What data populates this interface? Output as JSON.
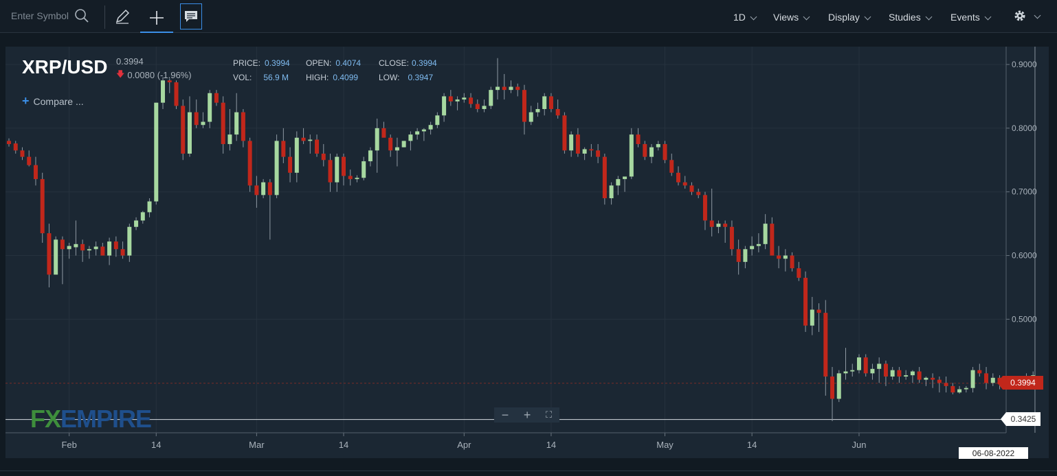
{
  "toolbar": {
    "symbol_placeholder": "Enter Symbol",
    "menus": [
      "1D",
      "Views",
      "Display",
      "Studies",
      "Events"
    ]
  },
  "header": {
    "symbol": "XRP/USD",
    "price": "0.3994",
    "change": "0.0080 (-1.96%)",
    "compare_label": "Compare ...",
    "stats": {
      "price_label": "PRICE:",
      "price": "0.3994",
      "vol_label": "VOL:",
      "vol": "56.9 M",
      "open_label": "OPEN:",
      "open": "0.4074",
      "high_label": "HIGH:",
      "high": "0.4099",
      "close_label": "CLOSE:",
      "close": "0.3994",
      "low_label": "LOW:",
      "low": "0.3947"
    }
  },
  "logo": {
    "fx": "FX",
    "empire": "EMPIRE"
  },
  "axis": {
    "last_price_tag": "0.3994",
    "crosshair_price_tag": "0.3425",
    "crosshair_date_tag": "06-08-2022"
  },
  "colors": {
    "up": "#a7d8a0",
    "down": "#c1271b",
    "background": "#1b2733",
    "accent": "#3b8fe8"
  },
  "chart_data": {
    "type": "candlestick",
    "title": "XRP/USD",
    "y_ticks": [
      "0.9000",
      "0.8000",
      "0.7000",
      "0.6000",
      "0.5000"
    ],
    "ylim": [
      0.32,
      0.93
    ],
    "x_ticks": [
      "Feb",
      "14",
      "Mar",
      "14",
      "Apr",
      "14",
      "May",
      "14",
      "Jun"
    ],
    "x_tick_days": [
      9,
      22,
      37,
      50,
      68,
      81,
      98,
      111,
      127
    ],
    "last_price": 0.3994,
    "crosshair_price": 0.3425,
    "candles": [
      [
        0.78,
        0.784,
        0.771,
        0.775
      ],
      [
        0.776,
        0.78,
        0.76,
        0.765
      ],
      [
        0.765,
        0.77,
        0.75,
        0.755
      ],
      [
        0.755,
        0.765,
        0.74,
        0.742
      ],
      [
        0.742,
        0.755,
        0.71,
        0.72
      ],
      [
        0.72,
        0.73,
        0.62,
        0.635
      ],
      [
        0.635,
        0.65,
        0.55,
        0.57
      ],
      [
        0.57,
        0.63,
        0.6,
        0.625
      ],
      [
        0.625,
        0.63,
        0.555,
        0.61
      ],
      [
        0.61,
        0.62,
        0.595,
        0.615
      ],
      [
        0.613,
        0.655,
        0.6,
        0.618
      ],
      [
        0.618,
        0.625,
        0.59,
        0.608
      ],
      [
        0.608,
        0.615,
        0.595,
        0.61
      ],
      [
        0.61,
        0.622,
        0.6,
        0.614
      ],
      [
        0.614,
        0.62,
        0.6,
        0.6
      ],
      [
        0.6,
        0.628,
        0.585,
        0.622
      ],
      [
        0.622,
        0.63,
        0.598,
        0.61
      ],
      [
        0.61,
        0.622,
        0.595,
        0.6
      ],
      [
        0.6,
        0.65,
        0.59,
        0.645
      ],
      [
        0.645,
        0.66,
        0.64,
        0.655
      ],
      [
        0.655,
        0.67,
        0.65,
        0.668
      ],
      [
        0.668,
        0.69,
        0.66,
        0.685
      ],
      [
        0.685,
        0.84,
        0.68,
        0.84
      ],
      [
        0.84,
        0.88,
        0.83,
        0.875
      ],
      [
        0.875,
        0.878,
        0.855,
        0.872
      ],
      [
        0.872,
        0.875,
        0.83,
        0.835
      ],
      [
        0.835,
        0.845,
        0.75,
        0.76
      ],
      [
        0.76,
        0.85,
        0.755,
        0.825
      ],
      [
        0.825,
        0.845,
        0.8,
        0.805
      ],
      [
        0.805,
        0.825,
        0.8,
        0.81
      ],
      [
        0.81,
        0.86,
        0.8,
        0.855
      ],
      [
        0.855,
        0.86,
        0.835,
        0.84
      ],
      [
        0.84,
        0.85,
        0.76,
        0.775
      ],
      [
        0.775,
        0.83,
        0.765,
        0.79
      ],
      [
        0.79,
        0.855,
        0.78,
        0.825
      ],
      [
        0.825,
        0.83,
        0.77,
        0.78
      ],
      [
        0.78,
        0.785,
        0.7,
        0.71
      ],
      [
        0.71,
        0.725,
        0.675,
        0.695
      ],
      [
        0.695,
        0.72,
        0.69,
        0.715
      ],
      [
        0.715,
        0.72,
        0.625,
        0.695
      ],
      [
        0.695,
        0.79,
        0.69,
        0.78
      ],
      [
        0.78,
        0.8,
        0.745,
        0.755
      ],
      [
        0.755,
        0.77,
        0.715,
        0.73
      ],
      [
        0.73,
        0.795,
        0.715,
        0.785
      ],
      [
        0.785,
        0.8,
        0.775,
        0.78
      ],
      [
        0.78,
        0.79,
        0.76,
        0.782
      ],
      [
        0.782,
        0.79,
        0.755,
        0.76
      ],
      [
        0.76,
        0.775,
        0.74,
        0.75
      ],
      [
        0.75,
        0.76,
        0.7,
        0.715
      ],
      [
        0.715,
        0.76,
        0.7,
        0.755
      ],
      [
        0.755,
        0.76,
        0.71,
        0.725
      ],
      [
        0.725,
        0.735,
        0.71,
        0.72
      ],
      [
        0.72,
        0.726,
        0.715,
        0.722
      ],
      [
        0.722,
        0.755,
        0.718,
        0.748
      ],
      [
        0.748,
        0.77,
        0.74,
        0.765
      ],
      [
        0.765,
        0.815,
        0.73,
        0.8
      ],
      [
        0.8,
        0.81,
        0.79,
        0.785
      ],
      [
        0.785,
        0.79,
        0.755,
        0.765
      ],
      [
        0.765,
        0.785,
        0.74,
        0.77
      ],
      [
        0.77,
        0.78,
        0.77,
        0.78
      ],
      [
        0.78,
        0.795,
        0.765,
        0.79
      ],
      [
        0.79,
        0.8,
        0.782,
        0.795
      ],
      [
        0.795,
        0.8,
        0.78,
        0.798
      ],
      [
        0.798,
        0.81,
        0.79,
        0.805
      ],
      [
        0.805,
        0.825,
        0.8,
        0.82
      ],
      [
        0.82,
        0.855,
        0.81,
        0.85
      ],
      [
        0.85,
        0.86,
        0.835,
        0.842
      ],
      [
        0.842,
        0.85,
        0.828,
        0.845
      ],
      [
        0.845,
        0.855,
        0.84,
        0.848
      ],
      [
        0.848,
        0.855,
        0.832,
        0.838
      ],
      [
        0.838,
        0.845,
        0.825,
        0.83
      ],
      [
        0.83,
        0.845,
        0.825,
        0.835
      ],
      [
        0.835,
        0.865,
        0.83,
        0.86
      ],
      [
        0.86,
        0.91,
        0.845,
        0.865
      ],
      [
        0.865,
        0.885,
        0.845,
        0.86
      ],
      [
        0.86,
        0.875,
        0.855,
        0.865
      ],
      [
        0.865,
        0.87,
        0.85,
        0.86
      ],
      [
        0.86,
        0.868,
        0.79,
        0.81
      ],
      [
        0.81,
        0.835,
        0.805,
        0.825
      ],
      [
        0.825,
        0.84,
        0.818,
        0.83
      ],
      [
        0.83,
        0.855,
        0.82,
        0.85
      ],
      [
        0.85,
        0.855,
        0.825,
        0.83
      ],
      [
        0.83,
        0.845,
        0.815,
        0.82
      ],
      [
        0.82,
        0.825,
        0.76,
        0.765
      ],
      [
        0.765,
        0.795,
        0.755,
        0.79
      ],
      [
        0.79,
        0.8,
        0.755,
        0.76
      ],
      [
        0.76,
        0.77,
        0.75,
        0.767
      ],
      [
        0.767,
        0.775,
        0.755,
        0.765
      ],
      [
        0.765,
        0.775,
        0.745,
        0.755
      ],
      [
        0.755,
        0.76,
        0.68,
        0.69
      ],
      [
        0.69,
        0.715,
        0.68,
        0.71
      ],
      [
        0.71,
        0.725,
        0.695,
        0.72
      ],
      [
        0.72,
        0.72,
        0.7,
        0.724
      ],
      [
        0.724,
        0.8,
        0.72,
        0.79
      ],
      [
        0.79,
        0.8,
        0.77,
        0.775
      ],
      [
        0.775,
        0.78,
        0.75,
        0.755
      ],
      [
        0.755,
        0.775,
        0.745,
        0.77
      ],
      [
        0.77,
        0.78,
        0.765,
        0.775
      ],
      [
        0.775,
        0.78,
        0.745,
        0.75
      ],
      [
        0.75,
        0.76,
        0.725,
        0.73
      ],
      [
        0.73,
        0.74,
        0.71,
        0.715
      ],
      [
        0.715,
        0.725,
        0.705,
        0.71
      ],
      [
        0.71,
        0.715,
        0.695,
        0.7
      ],
      [
        0.7,
        0.705,
        0.69,
        0.695
      ],
      [
        0.695,
        0.7,
        0.64,
        0.655
      ],
      [
        0.655,
        0.705,
        0.63,
        0.645
      ],
      [
        0.645,
        0.655,
        0.635,
        0.65
      ],
      [
        0.65,
        0.655,
        0.62,
        0.645
      ],
      [
        0.645,
        0.655,
        0.6,
        0.61
      ],
      [
        0.61,
        0.625,
        0.57,
        0.59
      ],
      [
        0.59,
        0.615,
        0.58,
        0.61
      ],
      [
        0.61,
        0.63,
        0.6,
        0.615
      ],
      [
        0.615,
        0.635,
        0.605,
        0.618
      ],
      [
        0.618,
        0.665,
        0.61,
        0.65
      ],
      [
        0.65,
        0.66,
        0.6,
        0.6
      ],
      [
        0.6,
        0.615,
        0.58,
        0.595
      ],
      [
        0.595,
        0.61,
        0.575,
        0.6
      ],
      [
        0.6,
        0.605,
        0.575,
        0.58
      ],
      [
        0.58,
        0.59,
        0.56,
        0.565
      ],
      [
        0.565,
        0.575,
        0.48,
        0.49
      ],
      [
        0.49,
        0.535,
        0.475,
        0.515
      ],
      [
        0.515,
        0.525,
        0.48,
        0.51
      ],
      [
        0.51,
        0.53,
        0.38,
        0.41
      ],
      [
        0.41,
        0.425,
        0.34,
        0.375
      ],
      [
        0.375,
        0.42,
        0.37,
        0.415
      ],
      [
        0.415,
        0.455,
        0.405,
        0.418
      ],
      [
        0.418,
        0.43,
        0.41,
        0.42
      ],
      [
        0.42,
        0.445,
        0.415,
        0.44
      ],
      [
        0.44,
        0.445,
        0.41,
        0.415
      ],
      [
        0.415,
        0.43,
        0.405,
        0.422
      ],
      [
        0.422,
        0.44,
        0.4,
        0.43
      ],
      [
        0.43,
        0.435,
        0.395,
        0.41
      ],
      [
        0.41,
        0.425,
        0.405,
        0.42
      ],
      [
        0.42,
        0.425,
        0.4,
        0.41
      ],
      [
        0.41,
        0.42,
        0.405,
        0.412
      ],
      [
        0.412,
        0.42,
        0.4,
        0.418
      ],
      [
        0.418,
        0.425,
        0.4,
        0.405
      ],
      [
        0.405,
        0.41,
        0.395,
        0.408
      ],
      [
        0.408,
        0.415,
        0.392,
        0.405
      ],
      [
        0.405,
        0.41,
        0.385,
        0.4
      ],
      [
        0.4,
        0.41,
        0.385,
        0.395
      ],
      [
        0.395,
        0.4,
        0.382,
        0.385
      ],
      [
        0.385,
        0.395,
        0.383,
        0.39
      ],
      [
        0.39,
        0.395,
        0.385,
        0.392
      ],
      [
        0.392,
        0.425,
        0.385,
        0.42
      ],
      [
        0.42,
        0.43,
        0.41,
        0.415
      ],
      [
        0.415,
        0.425,
        0.39,
        0.4
      ],
      [
        0.4,
        0.415,
        0.395,
        0.408
      ],
      [
        0.408,
        0.412,
        0.39,
        0.398
      ],
      [
        0.398,
        0.4,
        0.39,
        0.395
      ],
      [
        0.395,
        0.405,
        0.39,
        0.398
      ],
      [
        0.398,
        0.41,
        0.392,
        0.405
      ],
      [
        0.405,
        0.415,
        0.395,
        0.41
      ],
      [
        0.41,
        0.418,
        0.4,
        0.412
      ],
      [
        0.4074,
        0.4099,
        0.3947,
        0.3994
      ]
    ]
  }
}
